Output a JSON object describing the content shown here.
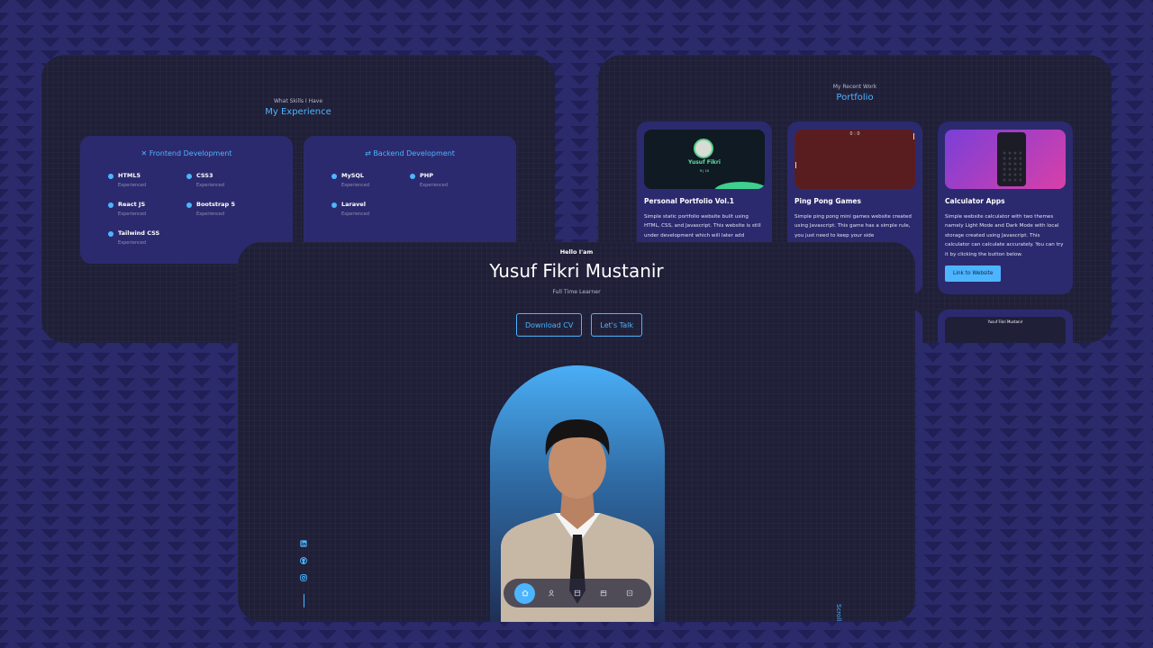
{
  "experience": {
    "subtitle": "What Skills I Have",
    "title": "My Experience",
    "frontend": {
      "title": "Frontend Development",
      "skills": [
        {
          "name": "HTML5",
          "level": "Experienced"
        },
        {
          "name": "CSS3",
          "level": "Experienced"
        },
        {
          "name": "React JS",
          "level": "Experienced"
        },
        {
          "name": "Bootstrap 5",
          "level": "Experienced"
        },
        {
          "name": "Tailwind CSS",
          "level": "Experienced"
        }
      ]
    },
    "backend": {
      "title": "Backend Development",
      "skills": [
        {
          "name": "MySQL",
          "level": "Experienced"
        },
        {
          "name": "PHP",
          "level": "Experienced"
        },
        {
          "name": "Laravel",
          "level": "Experienced"
        }
      ]
    }
  },
  "portfolio": {
    "subtitle": "My Recent Work",
    "title": "Portfolio",
    "items": [
      {
        "title": "Personal Portfolio Vol.1",
        "desc": "Simple static portfolio website built using HTML, CSS, and Javascript. This website is still under development which will later add",
        "thumb_name": "Yusuf Fikri",
        "thumb_score": "9 | 10"
      },
      {
        "title": "Ping Pong Games",
        "desc": "Simple ping pong mini games website created using Javascript. This game has a simple rule, you just need to keep your side",
        "thumb_score": "0 : 0"
      },
      {
        "title": "Calculator Apps",
        "desc": "Simple website calculator with two themes namely Light Mode and Dark Mode with local storage created using Javascript. This calculator can calculate accurately. You can try it by clicking the button below.",
        "button": "Link to Website"
      }
    ],
    "preview_name": "Yusuf Fikri Mustanir"
  },
  "hero": {
    "greeting": "Hello I'am",
    "name": "Yusuf Fikri Mustanir",
    "role": "Full Time Learner",
    "download_cv": "Download CV",
    "lets_talk": "Let's Talk",
    "scroll_down": "Scroll Down"
  },
  "colors": {
    "accent": "#4db5ff",
    "panel": "#1f1f38",
    "card": "#2c2a6e",
    "background": "#2b2a6b"
  },
  "icons": {
    "social": [
      "linkedin-icon",
      "github-icon",
      "instagram-icon"
    ],
    "nav": [
      "home-icon",
      "user-icon",
      "book-icon",
      "briefcase-icon",
      "message-icon"
    ]
  }
}
